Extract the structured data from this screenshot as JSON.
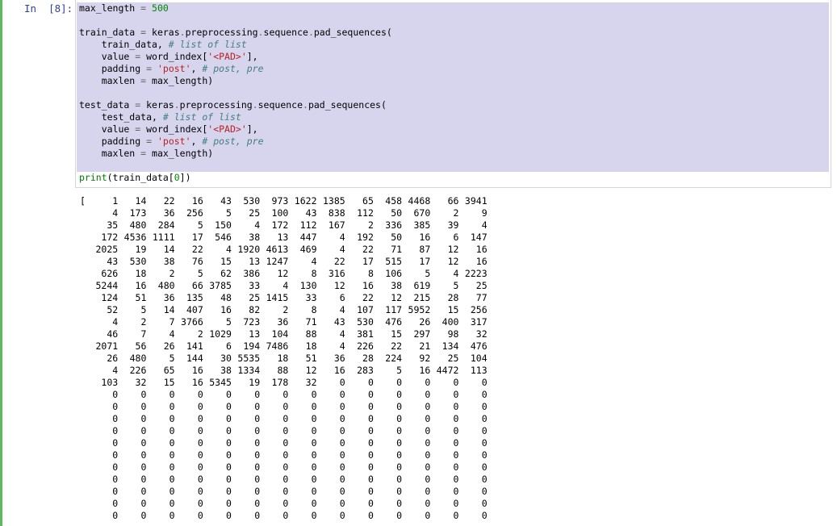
{
  "prompt": "In  [8]:",
  "code": {
    "line1": {
      "a": "max_length ",
      "op": "=",
      "b": " ",
      "num": "500"
    },
    "train_call": {
      "a": "train_data ",
      "op": "=",
      "b": " keras",
      "c": ".",
      "d": "preprocessing",
      "e": ".",
      "f": "sequence",
      "g": ".",
      "h": "pad_sequences("
    },
    "train_arg1": {
      "a": "    train_data, ",
      "com": "# list of list"
    },
    "train_arg2": {
      "a": "    value ",
      "op": "=",
      "b": " word_index[",
      "str": "'<PAD>'",
      "c": "],"
    },
    "train_arg3": {
      "a": "    padding ",
      "op": "=",
      "b": " ",
      "str": "'post'",
      "c": ", ",
      "com": "# post, pre"
    },
    "train_arg4": {
      "a": "    maxlen ",
      "op": "=",
      "b": " max_length)"
    },
    "test_call": {
      "a": "test_data ",
      "op": "=",
      "b": " keras",
      "c": ".",
      "d": "preprocessing",
      "e": ".",
      "f": "sequence",
      "g": ".",
      "h": "pad_sequences("
    },
    "test_arg1": {
      "a": "    test_data, ",
      "com": "# list of list"
    },
    "test_arg2": {
      "a": "    value ",
      "op": "=",
      "b": " word_index[",
      "str": "'<PAD>'",
      "c": "],"
    },
    "test_arg3": {
      "a": "    padding ",
      "op": "=",
      "b": " ",
      "str": "'post'",
      "c": ", ",
      "com": "# post, pre"
    },
    "test_arg4": {
      "a": "    maxlen ",
      "op": "=",
      "b": " max_length)"
    },
    "print_line": {
      "fn": "print",
      "a": "(train_data[",
      "num": "0",
      "b": "])"
    }
  },
  "output": {
    "open_bracket": "[",
    "rows": [
      [
        "1",
        "14",
        "22",
        "16",
        "43",
        "530",
        "973",
        "1622",
        "1385",
        "65",
        "458",
        "4468",
        "66",
        "3941"
      ],
      [
        "4",
        "173",
        "36",
        "256",
        "5",
        "25",
        "100",
        "43",
        "838",
        "112",
        "50",
        "670",
        "2",
        "9"
      ],
      [
        "35",
        "480",
        "284",
        "5",
        "150",
        "4",
        "172",
        "112",
        "167",
        "2",
        "336",
        "385",
        "39",
        "4"
      ],
      [
        "172",
        "4536",
        "1111",
        "17",
        "546",
        "38",
        "13",
        "447",
        "4",
        "192",
        "50",
        "16",
        "6",
        "147"
      ],
      [
        "2025",
        "19",
        "14",
        "22",
        "4",
        "1920",
        "4613",
        "469",
        "4",
        "22",
        "71",
        "87",
        "12",
        "16"
      ],
      [
        "43",
        "530",
        "38",
        "76",
        "15",
        "13",
        "1247",
        "4",
        "22",
        "17",
        "515",
        "17",
        "12",
        "16"
      ],
      [
        "626",
        "18",
        "2",
        "5",
        "62",
        "386",
        "12",
        "8",
        "316",
        "8",
        "106",
        "5",
        "4",
        "2223"
      ],
      [
        "5244",
        "16",
        "480",
        "66",
        "3785",
        "33",
        "4",
        "130",
        "12",
        "16",
        "38",
        "619",
        "5",
        "25"
      ],
      [
        "124",
        "51",
        "36",
        "135",
        "48",
        "25",
        "1415",
        "33",
        "6",
        "22",
        "12",
        "215",
        "28",
        "77"
      ],
      [
        "52",
        "5",
        "14",
        "407",
        "16",
        "82",
        "2",
        "8",
        "4",
        "107",
        "117",
        "5952",
        "15",
        "256"
      ],
      [
        "4",
        "2",
        "7",
        "3766",
        "5",
        "723",
        "36",
        "71",
        "43",
        "530",
        "476",
        "26",
        "400",
        "317"
      ],
      [
        "46",
        "7",
        "4",
        "2",
        "1029",
        "13",
        "104",
        "88",
        "4",
        "381",
        "15",
        "297",
        "98",
        "32"
      ],
      [
        "2071",
        "56",
        "26",
        "141",
        "6",
        "194",
        "7486",
        "18",
        "4",
        "226",
        "22",
        "21",
        "134",
        "476"
      ],
      [
        "26",
        "480",
        "5",
        "144",
        "30",
        "5535",
        "18",
        "51",
        "36",
        "28",
        "224",
        "92",
        "25",
        "104"
      ],
      [
        "4",
        "226",
        "65",
        "16",
        "38",
        "1334",
        "88",
        "12",
        "16",
        "283",
        "5",
        "16",
        "4472",
        "113"
      ],
      [
        "103",
        "32",
        "15",
        "16",
        "5345",
        "19",
        "178",
        "32",
        "0",
        "0",
        "0",
        "0",
        "0",
        "0"
      ],
      [
        "0",
        "0",
        "0",
        "0",
        "0",
        "0",
        "0",
        "0",
        "0",
        "0",
        "0",
        "0",
        "0",
        "0"
      ],
      [
        "0",
        "0",
        "0",
        "0",
        "0",
        "0",
        "0",
        "0",
        "0",
        "0",
        "0",
        "0",
        "0",
        "0"
      ],
      [
        "0",
        "0",
        "0",
        "0",
        "0",
        "0",
        "0",
        "0",
        "0",
        "0",
        "0",
        "0",
        "0",
        "0"
      ],
      [
        "0",
        "0",
        "0",
        "0",
        "0",
        "0",
        "0",
        "0",
        "0",
        "0",
        "0",
        "0",
        "0",
        "0"
      ],
      [
        "0",
        "0",
        "0",
        "0",
        "0",
        "0",
        "0",
        "0",
        "0",
        "0",
        "0",
        "0",
        "0",
        "0"
      ],
      [
        "0",
        "0",
        "0",
        "0",
        "0",
        "0",
        "0",
        "0",
        "0",
        "0",
        "0",
        "0",
        "0",
        "0"
      ],
      [
        "0",
        "0",
        "0",
        "0",
        "0",
        "0",
        "0",
        "0",
        "0",
        "0",
        "0",
        "0",
        "0",
        "0"
      ],
      [
        "0",
        "0",
        "0",
        "0",
        "0",
        "0",
        "0",
        "0",
        "0",
        "0",
        "0",
        "0",
        "0",
        "0"
      ],
      [
        "0",
        "0",
        "0",
        "0",
        "0",
        "0",
        "0",
        "0",
        "0",
        "0",
        "0",
        "0",
        "0",
        "0"
      ],
      [
        "0",
        "0",
        "0",
        "0",
        "0",
        "0",
        "0",
        "0",
        "0",
        "0",
        "0",
        "0",
        "0",
        "0"
      ],
      [
        "0",
        "0",
        "0",
        "0",
        "0",
        "0",
        "0",
        "0",
        "0",
        "0",
        "0",
        "0",
        "0",
        "0"
      ]
    ]
  }
}
